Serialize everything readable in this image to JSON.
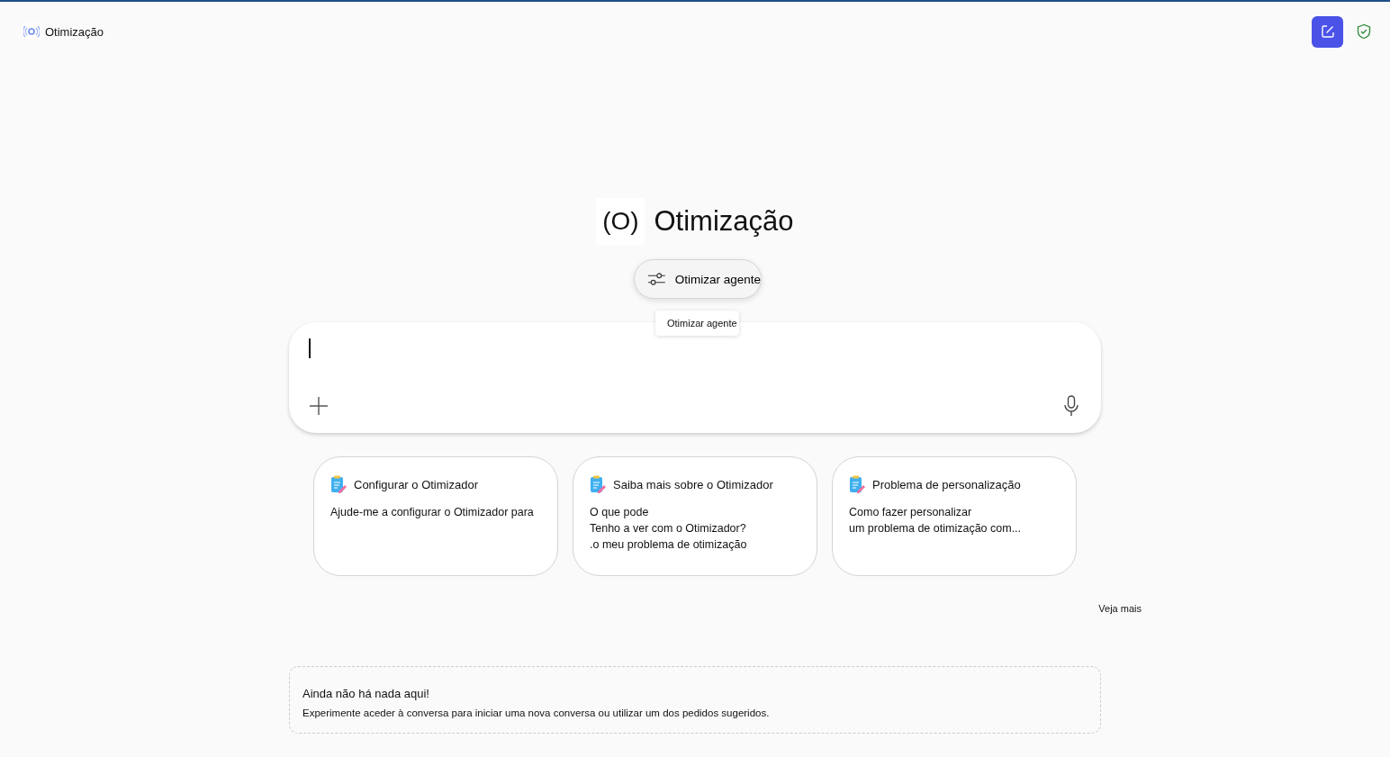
{
  "header": {
    "title": "Otimização"
  },
  "hero": {
    "logo": "(O)",
    "title": "Otimização"
  },
  "agent_button": {
    "label": "Otimizar agente"
  },
  "tooltip": {
    "text": "Otimizar agente"
  },
  "composer": {
    "focused": true
  },
  "suggestions": [
    {
      "title": "Configurar o Otimizador",
      "lines": [
        "Ajude-me a configurar o Otimizador para"
      ]
    },
    {
      "title": "Saiba mais sobre o Otimizador",
      "lines": [
        "O que pode",
        "Tenho a ver com o Otimizador?",
        ".o meu problema de otimização"
      ]
    },
    {
      "title": "Problema de personalização",
      "lines": [
        "Como fazer personalizar",
        "um problema de otimização com..."
      ]
    }
  ],
  "see_more": "Veja mais",
  "empty_state": {
    "title": "Ainda não há nada aqui!",
    "text": "Experimente aceder à conversa para iniciar uma nova conversa ou utilizar um dos pedidos sugeridos."
  }
}
